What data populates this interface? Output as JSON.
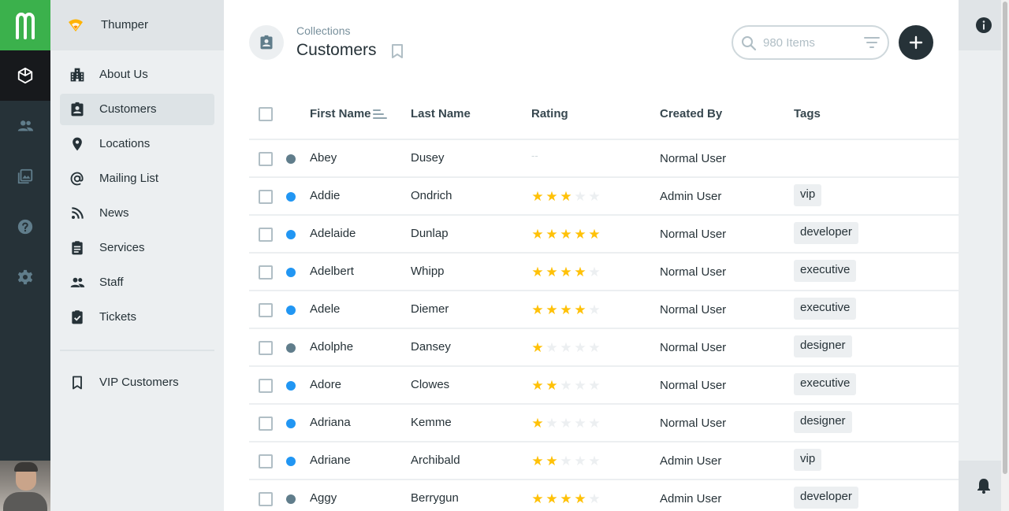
{
  "app": {
    "logo_letter": "m"
  },
  "project": {
    "name": "Thumper"
  },
  "nav": {
    "items": [
      {
        "label": "About Us",
        "icon": "building-icon"
      },
      {
        "label": "Customers",
        "icon": "contact-badge-icon"
      },
      {
        "label": "Locations",
        "icon": "map-pin-icon"
      },
      {
        "label": "Mailing List",
        "icon": "at-sign-icon"
      },
      {
        "label": "News",
        "icon": "rss-icon"
      },
      {
        "label": "Services",
        "icon": "clipboard-icon"
      },
      {
        "label": "Staff",
        "icon": "people-icon"
      },
      {
        "label": "Tickets",
        "icon": "checked-clipboard-icon"
      }
    ],
    "bookmarks": [
      {
        "label": "VIP Customers",
        "icon": "bookmark-icon"
      }
    ]
  },
  "header": {
    "breadcrumb": "Collections",
    "title": "Customers",
    "search_placeholder": "980 Items"
  },
  "table": {
    "columns": [
      "First Name",
      "Last Name",
      "Rating",
      "Created By",
      "Tags"
    ],
    "rows": [
      {
        "status": "#607d8b",
        "first": "Abey",
        "last": "Dusey",
        "rating": null,
        "rating_empty": "--",
        "created_by": "Normal User",
        "tag": ""
      },
      {
        "status": "#2196f3",
        "first": "Addie",
        "last": "Ondrich",
        "rating": 3,
        "created_by": "Admin User",
        "tag": "vip"
      },
      {
        "status": "#2196f3",
        "first": "Adelaide",
        "last": "Dunlap",
        "rating": 5,
        "created_by": "Normal User",
        "tag": "developer"
      },
      {
        "status": "#2196f3",
        "first": "Adelbert",
        "last": "Whipp",
        "rating": 4,
        "created_by": "Normal User",
        "tag": "executive"
      },
      {
        "status": "#2196f3",
        "first": "Adele",
        "last": "Diemer",
        "rating": 4,
        "created_by": "Normal User",
        "tag": "executive"
      },
      {
        "status": "#607d8b",
        "first": "Adolphe",
        "last": "Dansey",
        "rating": 1,
        "created_by": "Normal User",
        "tag": "designer"
      },
      {
        "status": "#2196f3",
        "first": "Adore",
        "last": "Clowes",
        "rating": 2,
        "created_by": "Normal User",
        "tag": "executive"
      },
      {
        "status": "#2196f3",
        "first": "Adriana",
        "last": "Kemme",
        "rating": 1,
        "created_by": "Normal User",
        "tag": "designer"
      },
      {
        "status": "#2196f3",
        "first": "Adriane",
        "last": "Archibald",
        "rating": 2,
        "created_by": "Admin User",
        "tag": "vip"
      },
      {
        "status": "#607d8b",
        "first": "Aggy",
        "last": "Berrygun",
        "rating": 4,
        "created_by": "Admin User",
        "tag": "developer"
      }
    ]
  },
  "colors": {
    "brand": "#3bb14c",
    "rail": "#263238",
    "star": "#ffc107"
  }
}
